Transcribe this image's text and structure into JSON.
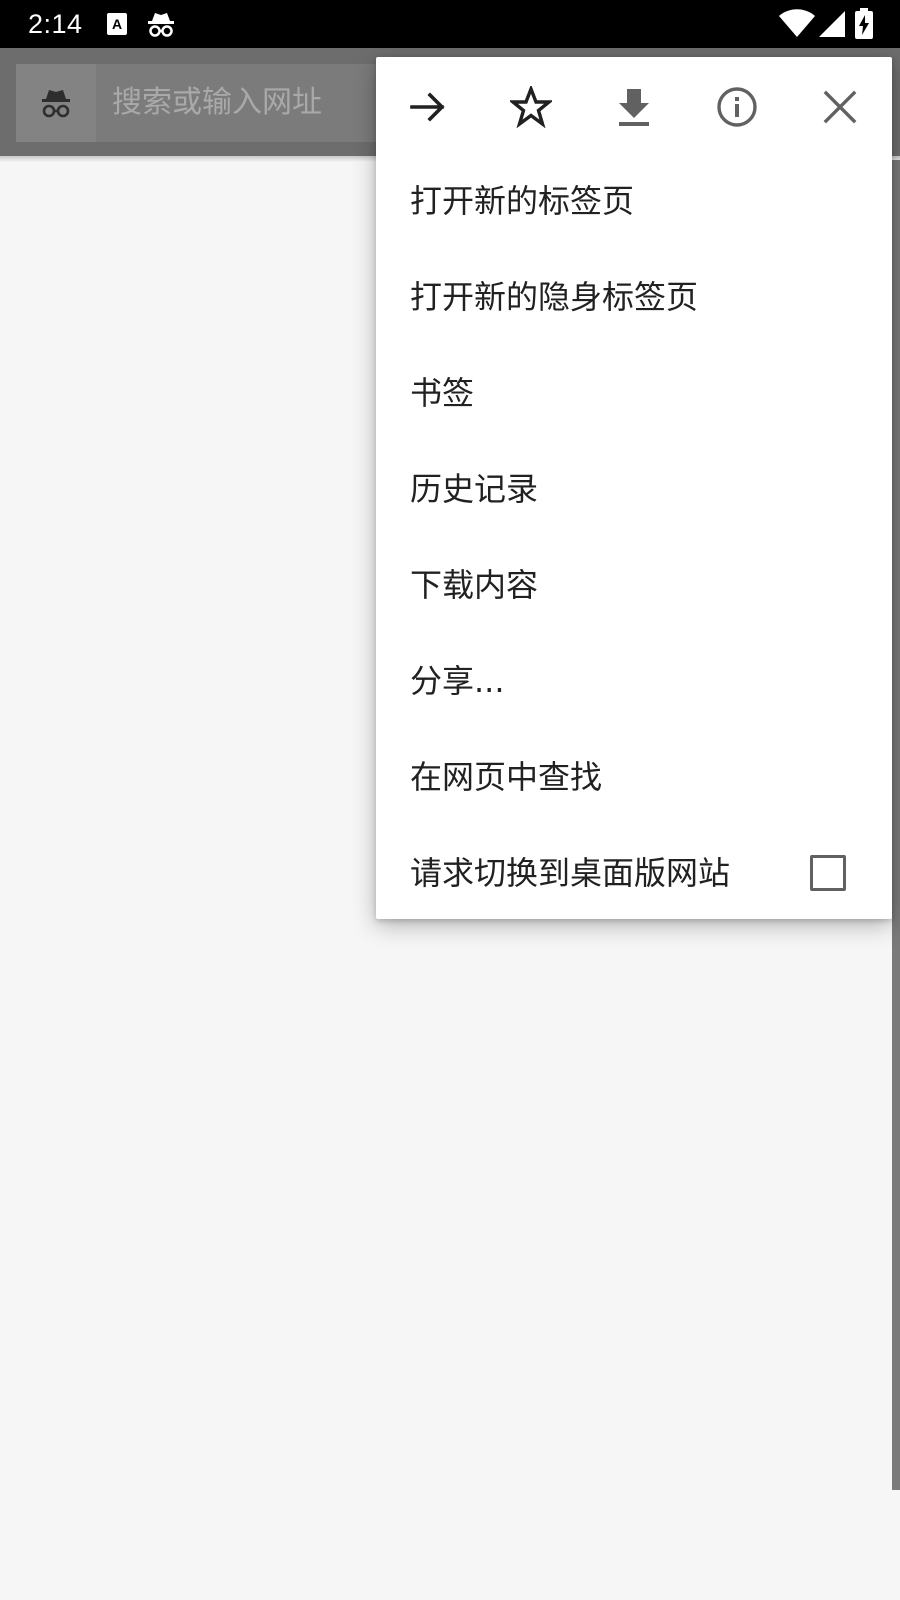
{
  "status_bar": {
    "time": "2:14",
    "icons": [
      "keyboard-a-icon",
      "incognito-small-icon",
      "wifi-icon",
      "signal-icon",
      "battery-charging-icon"
    ]
  },
  "omnibox": {
    "placeholder": "搜索或输入网址",
    "icon": "incognito-icon"
  },
  "menu": {
    "icon_row": [
      {
        "name": "forward-icon"
      },
      {
        "name": "bookmark-star-icon"
      },
      {
        "name": "download-icon"
      },
      {
        "name": "page-info-icon"
      },
      {
        "name": "close-icon"
      }
    ],
    "items": [
      {
        "label": "打开新的标签页"
      },
      {
        "label": "打开新的隐身标签页"
      },
      {
        "label": "书签"
      },
      {
        "label": "历史记录"
      },
      {
        "label": "下载内容"
      },
      {
        "label": "分享..."
      },
      {
        "label": "在网页中查找"
      },
      {
        "label": "请求切换到桌面版网站",
        "checked": false
      }
    ]
  },
  "colors": {
    "status_bar": "#000000",
    "toolbar": "#6d6d6d",
    "page_background": "#f6f6f6",
    "menu_background": "#ffffff",
    "menu_text": "#212121"
  }
}
